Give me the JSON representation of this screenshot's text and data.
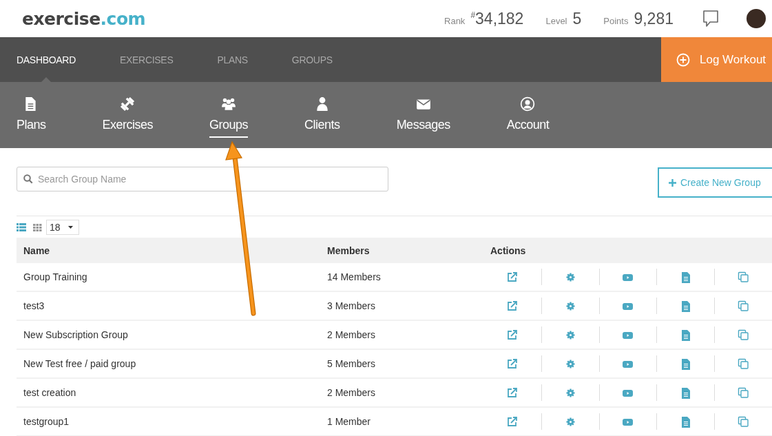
{
  "header": {
    "logo": {
      "name": "exercise",
      "suffix": ".com"
    },
    "stats": [
      {
        "label": "Rank",
        "value": "$^{#}$34,182"
      },
      {
        "label": "Level",
        "value": "5"
      },
      {
        "label": "Points",
        "value": "9,281"
      }
    ]
  },
  "main_nav": {
    "tabs": [
      {
        "label": "DASHBOARD",
        "selected": true
      },
      {
        "label": "EXERCISES",
        "selected": false
      },
      {
        "label": "PLANS",
        "selected": false
      },
      {
        "label": "GROUPS",
        "selected": false
      }
    ],
    "action_button": "Log Workout"
  },
  "sub_nav": [
    {
      "label": "Plans",
      "selected": false
    },
    {
      "label": "Exercises",
      "selected": false
    },
    {
      "label": "Groups",
      "selected": true
    },
    {
      "label": "Clients",
      "selected": false
    },
    {
      "label": "Messages",
      "selected": false
    },
    {
      "label": "Account",
      "selected": false
    }
  ],
  "search": {
    "placeholder": "Search Group Name"
  },
  "create_button": "Create New Group",
  "view_toggles": [
    {
      "selected": true
    },
    {
      "selected": false
    }
  ],
  "page_size": "18",
  "table": {
    "columns": [
      "Name",
      "Members",
      "Actions"
    ],
    "rows": [
      {
        "name": "Group Training",
        "members": "14 Members"
      },
      {
        "name": "test3",
        "members": "3 Members"
      },
      {
        "name": "New Subscription Group",
        "members": "2 Members"
      },
      {
        "name": "New Test free / paid group",
        "members": "5 Members"
      },
      {
        "name": "test creation",
        "members": "2 Members"
      },
      {
        "name": "testgroup1",
        "members": "1 Member"
      }
    ]
  }
}
